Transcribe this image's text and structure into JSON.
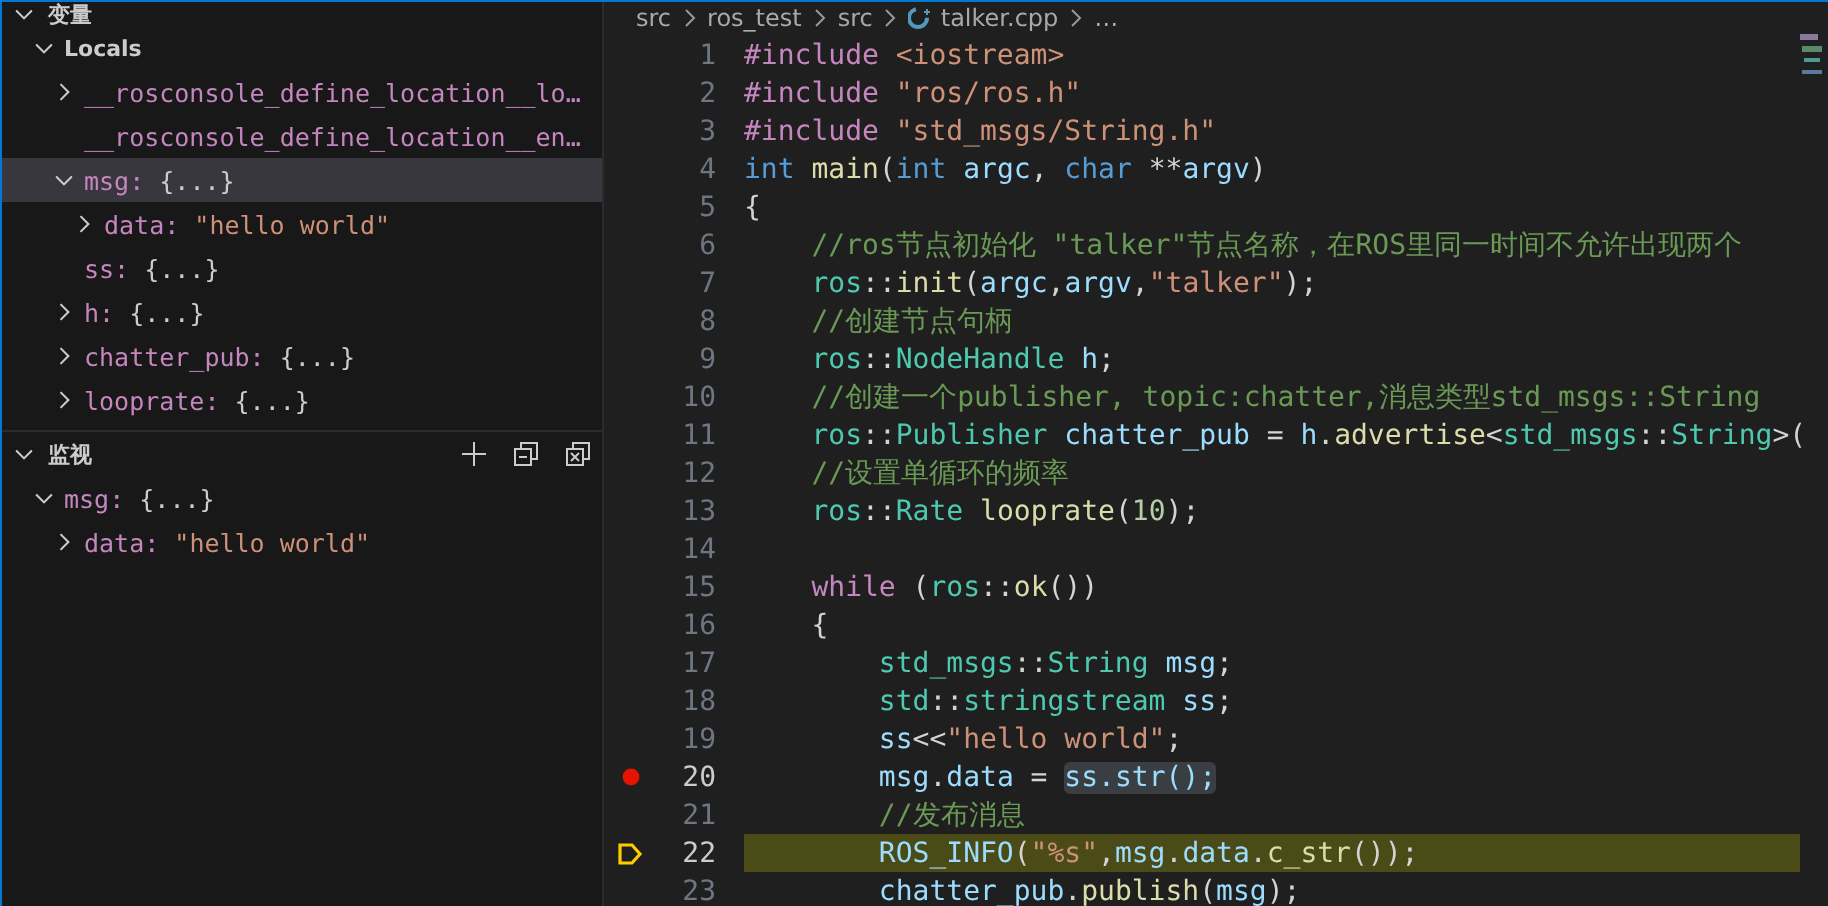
{
  "variables": {
    "title": "变量",
    "expanded": true,
    "scopes": [
      {
        "name": "Locals",
        "expanded": true,
        "children": [
          {
            "name": "__rosconsole_define_location__lo…",
            "kind": "object",
            "expanded": false
          },
          {
            "name": "__rosconsole_define_location__en…",
            "kind": "leaf"
          },
          {
            "name": "msg:",
            "value": "{...}",
            "kind": "object",
            "expanded": true,
            "selected": true,
            "children": [
              {
                "name": "data:",
                "value": "\"hello world\"",
                "kind": "string",
                "expanded": false
              }
            ]
          },
          {
            "name": "ss:",
            "value": "{...}",
            "kind": "leaf"
          },
          {
            "name": "h:",
            "value": "{...}",
            "kind": "object",
            "expanded": false
          },
          {
            "name": "chatter_pub:",
            "value": "{...}",
            "kind": "object",
            "expanded": false
          },
          {
            "name": "looprate:",
            "value": "{...}",
            "kind": "object",
            "expanded": false
          }
        ]
      }
    ]
  },
  "watch": {
    "title": "监视",
    "expanded": true,
    "items": [
      {
        "name": "msg:",
        "value": "{...}",
        "kind": "object",
        "expanded": true,
        "children": [
          {
            "name": "data:",
            "value": "\"hello world\"",
            "kind": "string",
            "expanded": false
          }
        ]
      }
    ]
  },
  "breadcrumb": [
    "src",
    "ros_test",
    "src",
    "talker.cpp",
    "…"
  ],
  "code": [
    {
      "number": "1",
      "tokens": [
        {
          "t": "#include ",
          "kind": "keyword"
        },
        {
          "t": "<iostream>",
          "kind": "string"
        }
      ]
    },
    {
      "number": "2",
      "tokens": [
        {
          "t": "#include ",
          "kind": "keyword"
        },
        {
          "t": "\"ros/ros.h\"",
          "kind": "string"
        }
      ]
    },
    {
      "number": "3",
      "tokens": [
        {
          "t": "#include ",
          "kind": "keyword"
        },
        {
          "t": "\"std_msgs/String.h\"",
          "kind": "string"
        }
      ]
    },
    {
      "number": "4",
      "tokens": [
        {
          "t": "int ",
          "kind": "type"
        },
        {
          "t": "main",
          "kind": "function"
        },
        {
          "t": "("
        },
        {
          "t": "int ",
          "kind": "type"
        },
        {
          "t": "argc",
          "kind": "variable"
        },
        {
          "t": ", "
        },
        {
          "t": "char ",
          "kind": "type"
        },
        {
          "t": "**"
        },
        {
          "t": "argv",
          "kind": "variable"
        },
        {
          "t": ")"
        }
      ]
    },
    {
      "number": "5",
      "tokens": [
        {
          "t": "{"
        }
      ]
    },
    {
      "number": "6",
      "tokens": [
        {
          "t": "    //ros节点初始化 \"talker\"节点名称，在ROS里同一时间不允许出现两个",
          "kind": "comment"
        }
      ]
    },
    {
      "number": "7",
      "tokens": [
        {
          "t": "    ros",
          "kind": "namespace"
        },
        {
          "t": "::"
        },
        {
          "t": "init",
          "kind": "function"
        },
        {
          "t": "("
        },
        {
          "t": "argc",
          "kind": "variable"
        },
        {
          "t": ","
        },
        {
          "t": "argv",
          "kind": "variable"
        },
        {
          "t": ","
        },
        {
          "t": "\"talker\"",
          "kind": "string"
        },
        {
          "t": ");"
        }
      ]
    },
    {
      "number": "8",
      "tokens": [
        {
          "t": "    //创建节点句柄",
          "kind": "comment"
        }
      ]
    },
    {
      "number": "9",
      "tokens": [
        {
          "t": "    ros",
          "kind": "namespace"
        },
        {
          "t": "::"
        },
        {
          "t": "NodeHandle ",
          "kind": "namespace"
        },
        {
          "t": "h",
          "kind": "variable"
        },
        {
          "t": ";"
        }
      ]
    },
    {
      "number": "10",
      "tokens": [
        {
          "t": "    //创建一个publisher, topic:chatter,消息类型std_msgs::String",
          "kind": "comment"
        }
      ]
    },
    {
      "number": "11",
      "tokens": [
        {
          "t": "    ros",
          "kind": "namespace"
        },
        {
          "t": "::"
        },
        {
          "t": "Publisher ",
          "kind": "namespace"
        },
        {
          "t": "chatter_pub",
          "kind": "variable"
        },
        {
          "t": " = "
        },
        {
          "t": "h",
          "kind": "variable"
        },
        {
          "t": "."
        },
        {
          "t": "advertise",
          "kind": "function"
        },
        {
          "t": "<"
        },
        {
          "t": "std_msgs",
          "kind": "namespace"
        },
        {
          "t": "::"
        },
        {
          "t": "String",
          "kind": "namespace"
        },
        {
          "t": ">("
        }
      ]
    },
    {
      "number": "12",
      "tokens": [
        {
          "t": "    //设置单循环的频率",
          "kind": "comment"
        }
      ]
    },
    {
      "number": "13",
      "tokens": [
        {
          "t": "    ros",
          "kind": "namespace"
        },
        {
          "t": "::"
        },
        {
          "t": "Rate ",
          "kind": "namespace"
        },
        {
          "t": "looprate",
          "kind": "function"
        },
        {
          "t": "("
        },
        {
          "t": "10",
          "kind": "number"
        },
        {
          "t": ");"
        }
      ]
    },
    {
      "number": "14"
    },
    {
      "number": "15",
      "tokens": [
        {
          "t": "    while ",
          "kind": "keyword"
        },
        {
          "t": "("
        },
        {
          "t": "ros",
          "kind": "namespace"
        },
        {
          "t": "::"
        },
        {
          "t": "ok",
          "kind": "function"
        },
        {
          "t": "())"
        }
      ]
    },
    {
      "number": "16",
      "tokens": [
        {
          "t": "    {"
        }
      ]
    },
    {
      "number": "17",
      "tokens": [
        {
          "t": "        std_msgs",
          "kind": "namespace"
        },
        {
          "t": "::"
        },
        {
          "t": "String ",
          "kind": "namespace"
        },
        {
          "t": "msg",
          "kind": "variable"
        },
        {
          "t": ";"
        }
      ]
    },
    {
      "number": "18",
      "tokens": [
        {
          "t": "        std",
          "kind": "namespace"
        },
        {
          "t": "::"
        },
        {
          "t": "stringstream ",
          "kind": "namespace"
        },
        {
          "t": "ss",
          "kind": "variable"
        },
        {
          "t": ";"
        }
      ]
    },
    {
      "number": "19",
      "tokens": [
        {
          "t": "        ss",
          "kind": "variable"
        },
        {
          "t": "<<"
        },
        {
          "t": "\"hello world\"",
          "kind": "string"
        },
        {
          "t": ";"
        }
      ]
    },
    {
      "number": "20",
      "breakpoint": true,
      "tokens": [
        {
          "t": "        msg",
          "kind": "variable"
        },
        {
          "t": "."
        },
        {
          "t": "data",
          "kind": "variable"
        },
        {
          "t": " = "
        },
        {
          "t": "ss.str();",
          "kind": "variable",
          "highlighted": true
        }
      ]
    },
    {
      "number": "21",
      "tokens": [
        {
          "t": "        //发布消息",
          "kind": "comment"
        }
      ]
    },
    {
      "number": "22",
      "current": true,
      "tokens": [
        {
          "t": "        ROS_INFO",
          "kind": "variable"
        },
        {
          "t": "("
        },
        {
          "t": "\"%s\"",
          "kind": "string"
        },
        {
          "t": ","
        },
        {
          "t": "msg",
          "kind": "variable"
        },
        {
          "t": "."
        },
        {
          "t": "data",
          "kind": "variable"
        },
        {
          "t": "."
        },
        {
          "t": "c_str",
          "kind": "function"
        },
        {
          "t": "());"
        }
      ]
    },
    {
      "number": "23",
      "tokens": [
        {
          "t": "        chatter_pub",
          "kind": "variable"
        },
        {
          "t": "."
        },
        {
          "t": "publish",
          "kind": "function"
        },
        {
          "t": "("
        },
        {
          "t": "msg",
          "kind": "variable"
        },
        {
          "t": ");"
        }
      ]
    }
  ]
}
